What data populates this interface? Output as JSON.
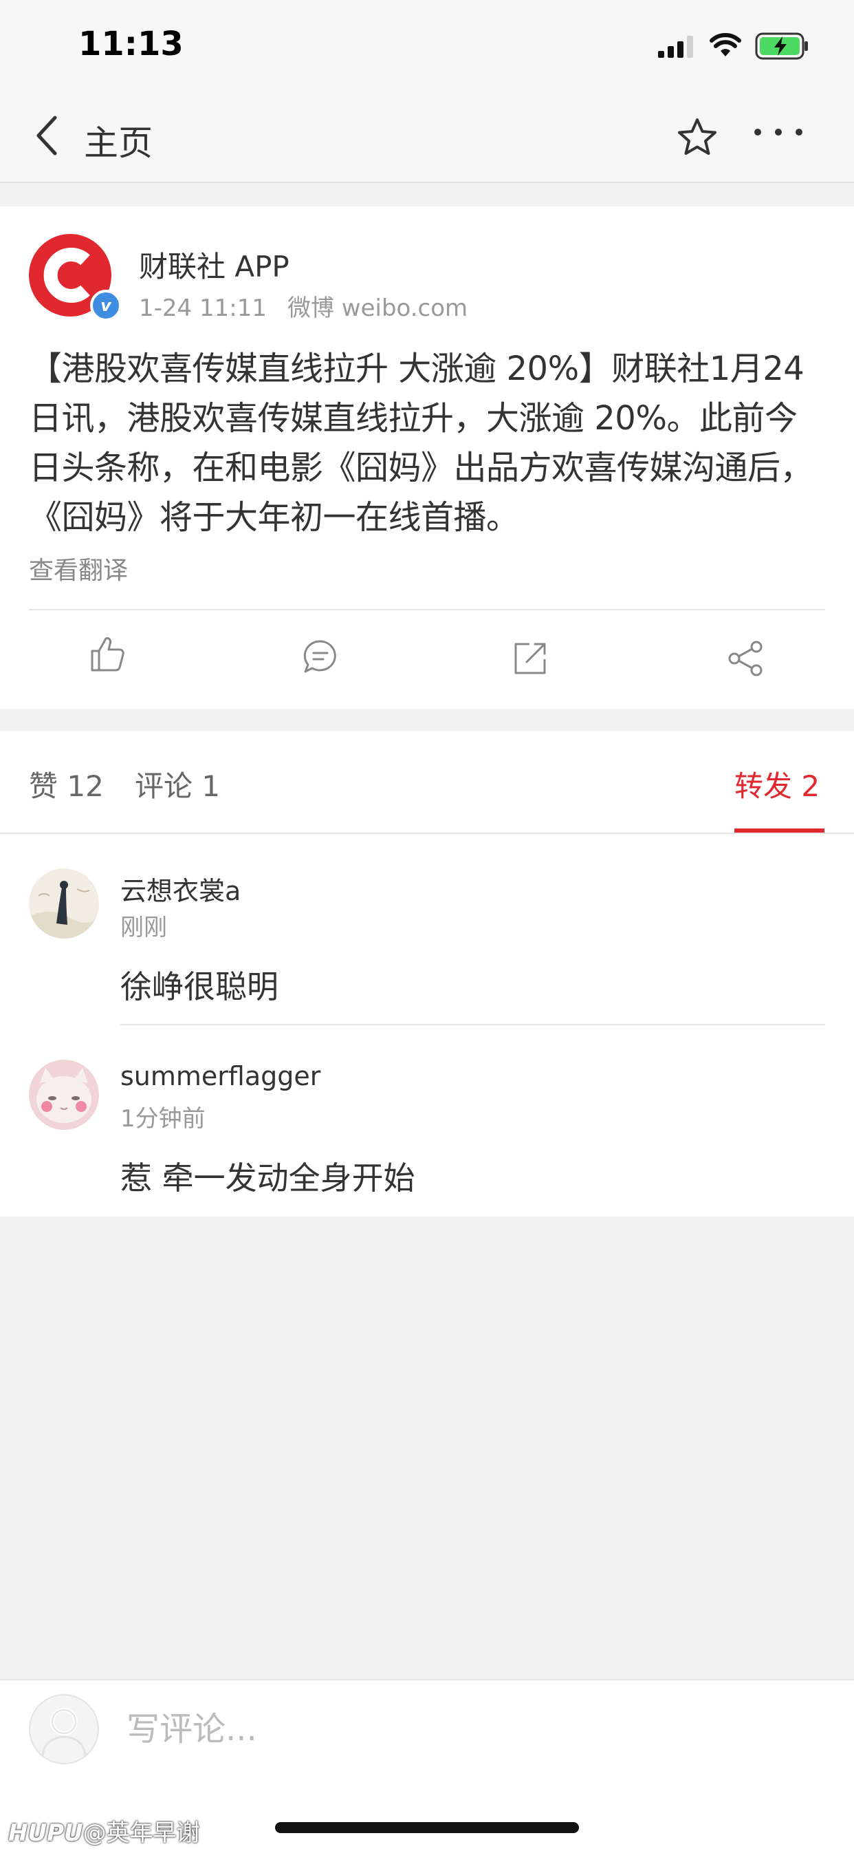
{
  "status_bar": {
    "time": "11:13"
  },
  "nav": {
    "back_label": "主页"
  },
  "post": {
    "author": "财联社 APP",
    "date": "1-24 11:11",
    "source": "微博 weibo.com",
    "text": "【港股欢喜传媒直线拉升 大涨逾 20%】财联社1月24日讯，港股欢喜传媒直线拉升，大涨逾 20%。此前今日头条称，在和电影《囧妈》出品方欢喜传媒沟通后，《囧妈》将于大年初一在线首播。",
    "translate_label": "查看翻译",
    "verified_mark": "v",
    "brand_color": "#e0282e"
  },
  "tabs": {
    "likes": "赞 12",
    "comments": "评论 1",
    "reposts": "转发 2",
    "active": "reposts",
    "active_color": "#e0282e"
  },
  "reposts": [
    {
      "name": "云想衣裳a",
      "time": "刚刚",
      "text": "徐峥很聪明"
    },
    {
      "name": "summerflagger",
      "time": "1分钟前",
      "text": "惹 牵一发动全身开始"
    }
  ],
  "composer": {
    "placeholder": "写评论..."
  },
  "watermark": {
    "brand": "HUPU",
    "handle": "@英年早谢"
  }
}
